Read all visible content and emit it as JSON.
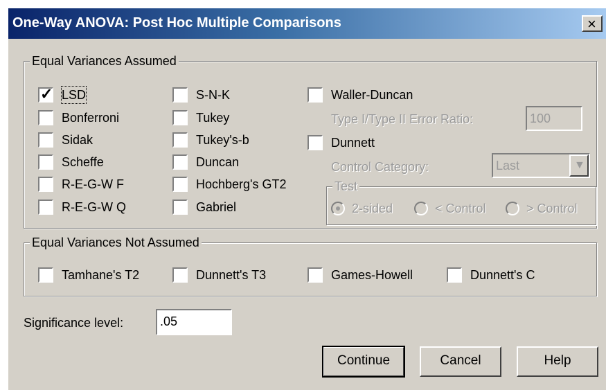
{
  "window": {
    "title": "One-Way ANOVA: Post Hoc Multiple Comparisons",
    "close_glyph": "×"
  },
  "equal_assumed": {
    "label": "Equal Variances Assumed",
    "col1": [
      {
        "label": "LSD",
        "checked": true
      },
      {
        "label": "Bonferroni",
        "checked": false
      },
      {
        "label": "Sidak",
        "checked": false
      },
      {
        "label": "Scheffe",
        "checked": false
      },
      {
        "label": "R-E-G-W F",
        "checked": false
      },
      {
        "label": "R-E-G-W Q",
        "checked": false
      }
    ],
    "col2": [
      {
        "label": "S-N-K",
        "checked": false
      },
      {
        "label": "Tukey",
        "checked": false
      },
      {
        "label": "Tukey's-b",
        "checked": false
      },
      {
        "label": "Duncan",
        "checked": false
      },
      {
        "label": "Hochberg's GT2",
        "checked": false
      },
      {
        "label": "Gabriel",
        "checked": false
      }
    ],
    "waller": {
      "label": "Waller-Duncan",
      "checked": false
    },
    "ratio_label": "Type I/Type II Error Ratio:",
    "ratio_value": "100",
    "dunnett": {
      "label": "Dunnett",
      "checked": false
    },
    "control_label": "Control Category:",
    "control_value": "Last",
    "test": {
      "label": "Test",
      "options": [
        "2-sided",
        "< Control",
        "> Control"
      ],
      "selected": "2-sided"
    }
  },
  "not_assumed": {
    "label": "Equal Variances Not Assumed",
    "items": [
      {
        "label": "Tamhane's T2",
        "checked": false
      },
      {
        "label": "Dunnett's T3",
        "checked": false
      },
      {
        "label": "Games-Howell",
        "checked": false
      },
      {
        "label": "Dunnett's C",
        "checked": false
      }
    ]
  },
  "significance": {
    "label": "Significance level:",
    "value": ".05"
  },
  "buttons": {
    "continue": "Continue",
    "cancel": "Cancel",
    "help": "Help"
  }
}
